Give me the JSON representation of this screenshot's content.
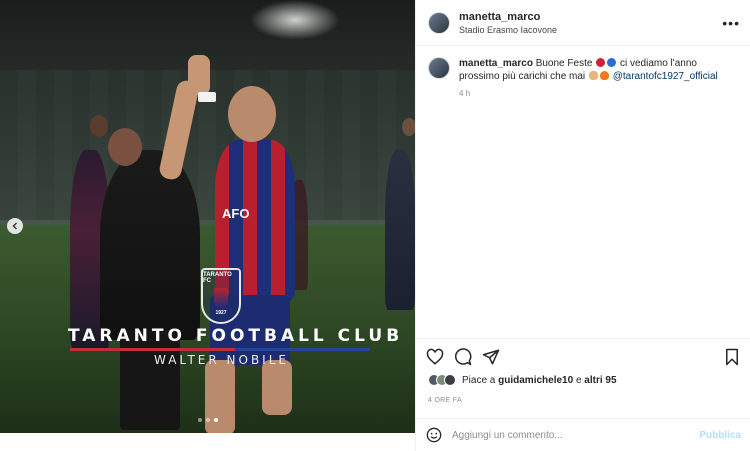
{
  "post": {
    "username": "manetta_marco",
    "location": "Stadio Erasmo Iacovone",
    "more_icon": "more-options-icon"
  },
  "media": {
    "logo_text": "TARANTO FC",
    "logo_year": "1927",
    "club_title": "TARANTO FOOTBALL CLUB 1927",
    "registered_mark": "©",
    "photographer": "WALTER NOBILE",
    "jersey_sponsor": "AFO",
    "carousel_count": 3,
    "carousel_active": 3
  },
  "caption": {
    "username": "manetta_marco",
    "text_1": "Buone Feste",
    "text_2": "ci vediamo l'anno prossimo più carichi che mai",
    "mention": "@tarantofc1927_official",
    "time": "4 h"
  },
  "likes": {
    "prefix": "Piace a",
    "user": "guidamichele10",
    "middle": "e",
    "others": "altri 95"
  },
  "posted_ago": "4 ORE FA",
  "comment": {
    "placeholder": "Aggiungi un commento...",
    "publish": "Pubblica"
  },
  "colors": {
    "accent": "#0095f6",
    "publish_disabled": "#b2dffc",
    "club_red": "#c52b3a",
    "club_blue": "#22479b"
  }
}
